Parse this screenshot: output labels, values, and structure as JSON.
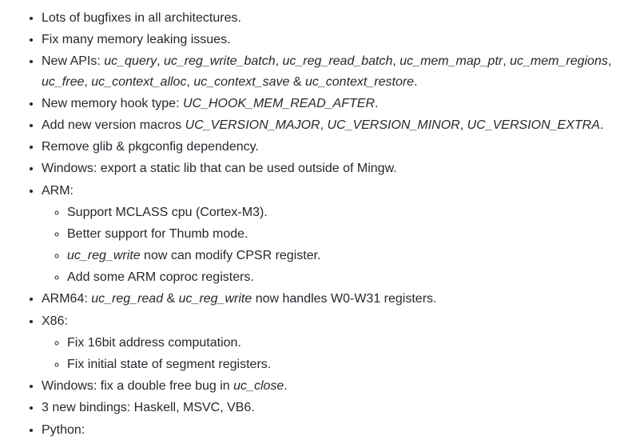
{
  "items": [
    {
      "type": "text",
      "text": "Lots of bugfixes in all architectures."
    },
    {
      "type": "text",
      "text": "Fix many memory leaking issues."
    },
    {
      "type": "apis",
      "prefix": "New APIs: ",
      "codes": [
        "uc_query",
        "uc_reg_write_batch",
        "uc_reg_read_batch",
        "uc_mem_map_ptr",
        "uc_mem_regions",
        "uc_free",
        "uc_context_alloc",
        "uc_context_save"
      ],
      "amp": " & ",
      "last": "uc_context_restore",
      "suffix": "."
    },
    {
      "type": "hook",
      "prefix": "New memory hook type: ",
      "code": "UC_HOOK_MEM_READ_AFTER",
      "suffix": "."
    },
    {
      "type": "macros",
      "prefix": "Add new version macros ",
      "codes": [
        "UC_VERSION_MAJOR",
        "UC_VERSION_MINOR",
        "UC_VERSION_EXTRA"
      ],
      "suffix": "."
    },
    {
      "type": "text",
      "text": "Remove glib & pkgconfig dependency."
    },
    {
      "type": "text",
      "text": "Windows: export a static lib that can be used outside of Mingw."
    },
    {
      "type": "arm",
      "label": "ARM:",
      "sub": [
        {
          "text": "Support MCLASS cpu (Cortex-M3)."
        },
        {
          "text": "Better support for Thumb mode."
        },
        {
          "code": "uc_reg_write",
          "after": " now can modify CPSR register."
        },
        {
          "text": "Add some ARM coproc registers."
        }
      ]
    },
    {
      "type": "arm64",
      "prefix": "ARM64: ",
      "code1": "uc_reg_read",
      "amp": " & ",
      "code2": "uc_reg_write",
      "suffix": " now handles W0-W31 registers."
    },
    {
      "type": "x86",
      "label": "X86:",
      "sub": [
        {
          "text": "Fix 16bit address computation."
        },
        {
          "text": "Fix initial state of segment registers."
        }
      ]
    },
    {
      "type": "winbug",
      "prefix": "Windows: fix a double free bug in ",
      "code": "uc_close",
      "suffix": "."
    },
    {
      "type": "text",
      "text": "3 new bindings: Haskell, MSVC, VB6."
    },
    {
      "type": "text",
      "text": "Python:"
    }
  ]
}
